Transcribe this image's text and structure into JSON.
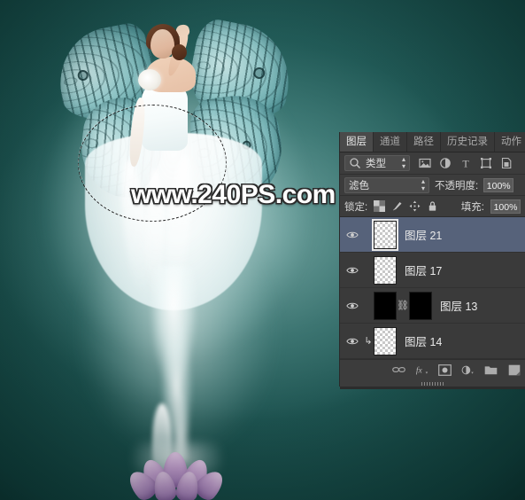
{
  "app": {
    "name": "Adobe Photoshop",
    "document_description": "Bride with butterfly wings rising from a lotus flower"
  },
  "canvas": {
    "watermark_text": "www.240PS.com",
    "selection_tool": "elliptical-marquee-selection",
    "background_color": "#134a46",
    "glow_color": "#eef8f7",
    "wing_color": "#9ecccd",
    "lotus_color": "#b386c2",
    "dress_color": "#ffffff"
  },
  "panel": {
    "tabs": [
      {
        "label": "图层",
        "active": true
      },
      {
        "label": "通道",
        "active": false
      },
      {
        "label": "路径",
        "active": false
      },
      {
        "label": "历史记录",
        "active": false
      },
      {
        "label": "动作",
        "active": false
      }
    ],
    "filter_row": {
      "search_icon": "magnifier-icon",
      "kind_label": "类型",
      "icons": [
        "pixel-layer-filter-icon",
        "adjustment-layer-filter-icon",
        "type-layer-filter-icon",
        "shape-layer-filter-icon",
        "smart-object-filter-icon"
      ]
    },
    "blend_row": {
      "blend_mode": "滤色",
      "opacity_label": "不透明度:",
      "opacity_value": "100%"
    },
    "lock_row": {
      "lock_label": "锁定:",
      "lock_icons": [
        "lock-transparent-pixels-icon",
        "lock-image-pixels-icon",
        "lock-position-icon",
        "lock-all-icon"
      ],
      "fill_label": "填充:",
      "fill_value": "100%"
    },
    "layers": [
      {
        "name": "图层 21",
        "visible": true,
        "selected": true,
        "thumbnail": "transparent",
        "has_mask": false,
        "clipped": false
      },
      {
        "name": "图层 17",
        "visible": true,
        "selected": false,
        "thumbnail": "transparent",
        "has_mask": false,
        "clipped": false
      },
      {
        "name": "图层 13",
        "visible": true,
        "selected": false,
        "thumbnail": "black",
        "has_mask": true,
        "mask_thumbnail": "black",
        "clipped": false
      },
      {
        "name": "图层 14",
        "visible": true,
        "selected": false,
        "thumbnail": "transparent",
        "has_mask": false,
        "clipped": true
      }
    ],
    "footer_buttons": [
      "link-layers-icon",
      "layer-style-fx-icon",
      "add-layer-mask-icon",
      "new-adjustment-layer-icon",
      "new-group-icon",
      "new-layer-icon"
    ],
    "colors": {
      "panel_background": "#3c3c3c",
      "selected_row": "#56627a",
      "text": "#e6e6e6",
      "tab_active": "#4a4a4a"
    }
  }
}
